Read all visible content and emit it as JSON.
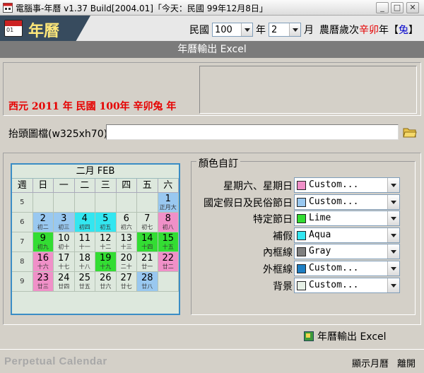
{
  "window": {
    "title": "電腦事-年曆 v1.37 Build[2004.01]「今天：民國 99年12月8日」",
    "minimize_glyph": "_",
    "maximize_glyph": "□",
    "close_glyph": "✕"
  },
  "header": {
    "logo_text": "年曆",
    "logo_icon_text": "01",
    "era_label": "民國",
    "year_value": "100",
    "year_unit": "年",
    "month_value": "2",
    "month_unit": "月",
    "lunar_prefix": "農曆歲次",
    "lunar_ganzhi": "辛卯",
    "lunar_year_char": "年",
    "zodiac_open": "【",
    "zodiac": "兔",
    "zodiac_close": "】"
  },
  "section_title": "年曆輸出 Excel",
  "year_line": "西元  2011  年  民國  100年  辛卯兔  年",
  "file_field": {
    "label": "抬頭圖檔(w325xh70)",
    "value": ""
  },
  "calendar": {
    "title": "二月 FEB",
    "headers": [
      "週",
      "日",
      "一",
      "二",
      "三",
      "四",
      "五",
      "六"
    ],
    "weeks": [
      {
        "num": "5",
        "days": [
          {
            "d": "",
            "l": "",
            "c": ""
          },
          {
            "d": "",
            "l": "",
            "c": ""
          },
          {
            "d": "",
            "l": "",
            "c": ""
          },
          {
            "d": "",
            "l": "",
            "c": ""
          },
          {
            "d": "",
            "l": "",
            "c": ""
          },
          {
            "d": "",
            "l": "",
            "c": ""
          },
          {
            "d": "1",
            "l": "正月大",
            "c": "#99c8f0"
          }
        ]
      },
      {
        "num": "6",
        "days": [
          {
            "d": "2",
            "l": "初二",
            "c": "#99c8f0"
          },
          {
            "d": "3",
            "l": "初三",
            "c": "#99c8f0"
          },
          {
            "d": "4",
            "l": "初四",
            "c": "#33e6f0"
          },
          {
            "d": "5",
            "l": "初五",
            "c": "#33e6f0"
          },
          {
            "d": "6",
            "l": "初六",
            "c": ""
          },
          {
            "d": "7",
            "l": "初七",
            "c": ""
          },
          {
            "d": "8",
            "l": "初八",
            "c": "#f090c8"
          }
        ]
      },
      {
        "num": "7",
        "days": [
          {
            "d": "9",
            "l": "初九",
            "c": "#33dd33"
          },
          {
            "d": "10",
            "l": "初十",
            "c": ""
          },
          {
            "d": "11",
            "l": "十一",
            "c": ""
          },
          {
            "d": "12",
            "l": "十二",
            "c": ""
          },
          {
            "d": "13",
            "l": "十三",
            "c": ""
          },
          {
            "d": "14",
            "l": "十四",
            "c": "#33dd33"
          },
          {
            "d": "15",
            "l": "十五",
            "c": "#33dd33"
          }
        ]
      },
      {
        "num": "8",
        "days": [
          {
            "d": "16",
            "l": "十六",
            "c": "#f090c8"
          },
          {
            "d": "17",
            "l": "十七",
            "c": ""
          },
          {
            "d": "18",
            "l": "十八",
            "c": ""
          },
          {
            "d": "19",
            "l": "十九",
            "c": "#33dd33"
          },
          {
            "d": "20",
            "l": "二十",
            "c": ""
          },
          {
            "d": "21",
            "l": "廿一",
            "c": ""
          },
          {
            "d": "22",
            "l": "廿二",
            "c": "#f090c8"
          }
        ]
      },
      {
        "num": "9",
        "days": [
          {
            "d": "23",
            "l": "廿三",
            "c": "#f090c8"
          },
          {
            "d": "24",
            "l": "廿四",
            "c": ""
          },
          {
            "d": "25",
            "l": "廿五",
            "c": ""
          },
          {
            "d": "26",
            "l": "廿六",
            "c": ""
          },
          {
            "d": "27",
            "l": "廿七",
            "c": ""
          },
          {
            "d": "28",
            "l": "廿八",
            "c": "#99c8f0"
          },
          {
            "d": "",
            "l": "",
            "c": ""
          }
        ]
      }
    ]
  },
  "colors": {
    "legend": "顏色自訂",
    "items": [
      {
        "label": "星期六、星期日",
        "value": "Custom...",
        "swatch": "#f090c8"
      },
      {
        "label": "國定假日及民俗節日",
        "value": "Custom...",
        "swatch": "#99c8f0"
      },
      {
        "label": "特定節日",
        "value": "Lime",
        "swatch": "#33dd33"
      },
      {
        "label": "補假",
        "value": "Aqua",
        "swatch": "#33e6f0"
      },
      {
        "label": "內框線",
        "value": "Gray",
        "swatch": "#808080"
      },
      {
        "label": "外框線",
        "value": "Custom...",
        "swatch": "#1e7fc4"
      },
      {
        "label": "背景",
        "value": "Custom...",
        "swatch": "#e6f0e6"
      }
    ]
  },
  "export_label": "年曆輸出 Excel",
  "status": {
    "brand": "Perpetual Calendar",
    "show_calendar": "顯示月曆",
    "exit": "離開"
  }
}
